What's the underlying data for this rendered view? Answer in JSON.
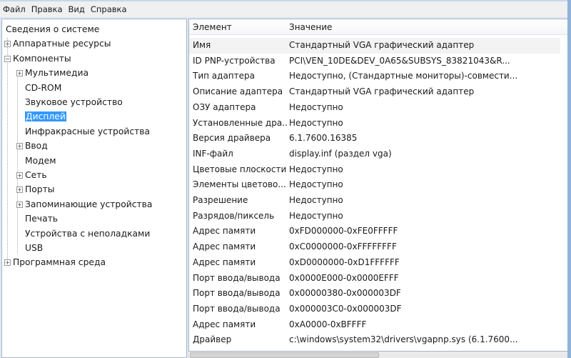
{
  "menu": [
    "Файл",
    "Правка",
    "Вид",
    "Справка"
  ],
  "tree": [
    {
      "label": "Сведения о системе",
      "level": 0,
      "toggle": ""
    },
    {
      "label": "Аппаратные ресурсы",
      "level": 0,
      "toggle": "+"
    },
    {
      "label": "Компоненты",
      "level": 0,
      "toggle": "−"
    },
    {
      "label": "Мультимедиа",
      "level": 1,
      "toggle": "+"
    },
    {
      "label": "CD-ROM",
      "level": 1,
      "toggle": ""
    },
    {
      "label": "Звуковое устройство",
      "level": 1,
      "toggle": ""
    },
    {
      "label": "Дисплей",
      "level": 1,
      "toggle": "",
      "selected": true
    },
    {
      "label": "Инфракрасные устройства",
      "level": 1,
      "toggle": ""
    },
    {
      "label": "Ввод",
      "level": 1,
      "toggle": "+"
    },
    {
      "label": "Модем",
      "level": 1,
      "toggle": ""
    },
    {
      "label": "Сеть",
      "level": 1,
      "toggle": "+"
    },
    {
      "label": "Порты",
      "level": 1,
      "toggle": "+"
    },
    {
      "label": "Запоминающие устройства",
      "level": 1,
      "toggle": "+"
    },
    {
      "label": "Печать",
      "level": 1,
      "toggle": ""
    },
    {
      "label": "Устройства с неполадками",
      "level": 1,
      "toggle": ""
    },
    {
      "label": "USB",
      "level": 1,
      "toggle": ""
    },
    {
      "label": "Программная среда",
      "level": 0,
      "toggle": "+"
    }
  ],
  "table": {
    "headers": [
      "Элемент",
      "Значение"
    ],
    "rows": [
      [
        "Имя",
        "Стандартный VGA графический адаптер"
      ],
      [
        "ID PNP-устройства",
        "PCI\\VEN_10DE&DEV_0A65&SUBSYS_83821043&R..."
      ],
      [
        "Тип адаптера",
        "Недоступно, (Стандартные мониторы)-совмести..."
      ],
      [
        "Описание адаптера",
        "Стандартный VGA графический адаптер"
      ],
      [
        "ОЗУ адаптера",
        "Недоступно"
      ],
      [
        "Установленные дра...",
        "Недоступно"
      ],
      [
        "Версия драйвера",
        "6.1.7600.16385"
      ],
      [
        "INF-файл",
        "display.inf (раздел vga)"
      ],
      [
        "Цветовые плоскости",
        "Недоступно"
      ],
      [
        "Элементы цветово...",
        "Недоступно"
      ],
      [
        "Разрешение",
        "Недоступно"
      ],
      [
        "Разрядов/пиксель",
        "Недоступно"
      ],
      [
        "Адрес памяти",
        "0xFD000000-0xFE0FFFFF"
      ],
      [
        "Адрес памяти",
        "0xC0000000-0xFFFFFFFF"
      ],
      [
        "Адрес памяти",
        "0xD0000000-0xD1FFFFFF"
      ],
      [
        "Порт ввода/вывода",
        "0x0000E000-0x0000EFFF"
      ],
      [
        "Порт ввода/вывода",
        "0x00000380-0x000003DF"
      ],
      [
        "Порт ввода/вывода",
        "0x000003C0-0x000003DF"
      ],
      [
        "Адрес памяти",
        "0xA0000-0xBFFFF"
      ],
      [
        "Драйвер",
        "c:\\windows\\system32\\drivers\\vgapnp.sys (6.1.7600..."
      ]
    ]
  }
}
